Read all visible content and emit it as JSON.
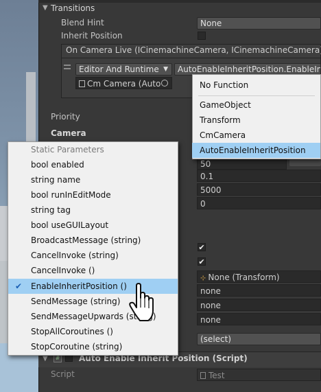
{
  "transitions": {
    "title": "Transitions",
    "blend_hint_label": "Blend Hint",
    "blend_hint_value": "None",
    "inherit_position_label": "Inherit Position",
    "event_header": "On Camera Live (ICinemachineCamera, ICinemachineCamera)",
    "runtime_option": "Editor And Runtime",
    "function_value": "AutoEnableInheritPosition.EnableInhe",
    "object_value": "Cm Camera (Auto"
  },
  "priority_label": "Priority",
  "camera_label": "Camera",
  "values": {
    "v1": "50",
    "v2": "0.1",
    "v3": "5000",
    "v4": "0"
  },
  "object_fields": {
    "none_transform": "None (Transform)",
    "none_a": "none",
    "none_b": "none",
    "none_c": "none",
    "select": "(select)"
  },
  "component": {
    "title": "Auto Enable Inherit Position (Script)",
    "script_label": "Script",
    "script_value": "Test"
  },
  "function_menu": {
    "items": [
      "No Function",
      "GameObject",
      "Transform",
      "CmCamera",
      "AutoEnableInheritPosition"
    ],
    "selected": "AutoEnableInheritPosition"
  },
  "params_menu": {
    "header": "Static Parameters",
    "items": [
      "bool enabled",
      "string name",
      "bool runInEditMode",
      "string tag",
      "bool useGUILayout",
      "BroadcastMessage (string)",
      "CancelInvoke (string)",
      "CancelInvoke ()",
      "EnableInheritPosition ()",
      "SendMessage (string)",
      "SendMessageUpwards (string)",
      "StopAllCoroutines ()",
      "StopCoroutine (string)"
    ],
    "selected": "EnableInheritPosition ()",
    "check_glyph": "✔"
  },
  "colors": {
    "highlight": "#9fcff3",
    "inspector_bg": "#383838"
  }
}
